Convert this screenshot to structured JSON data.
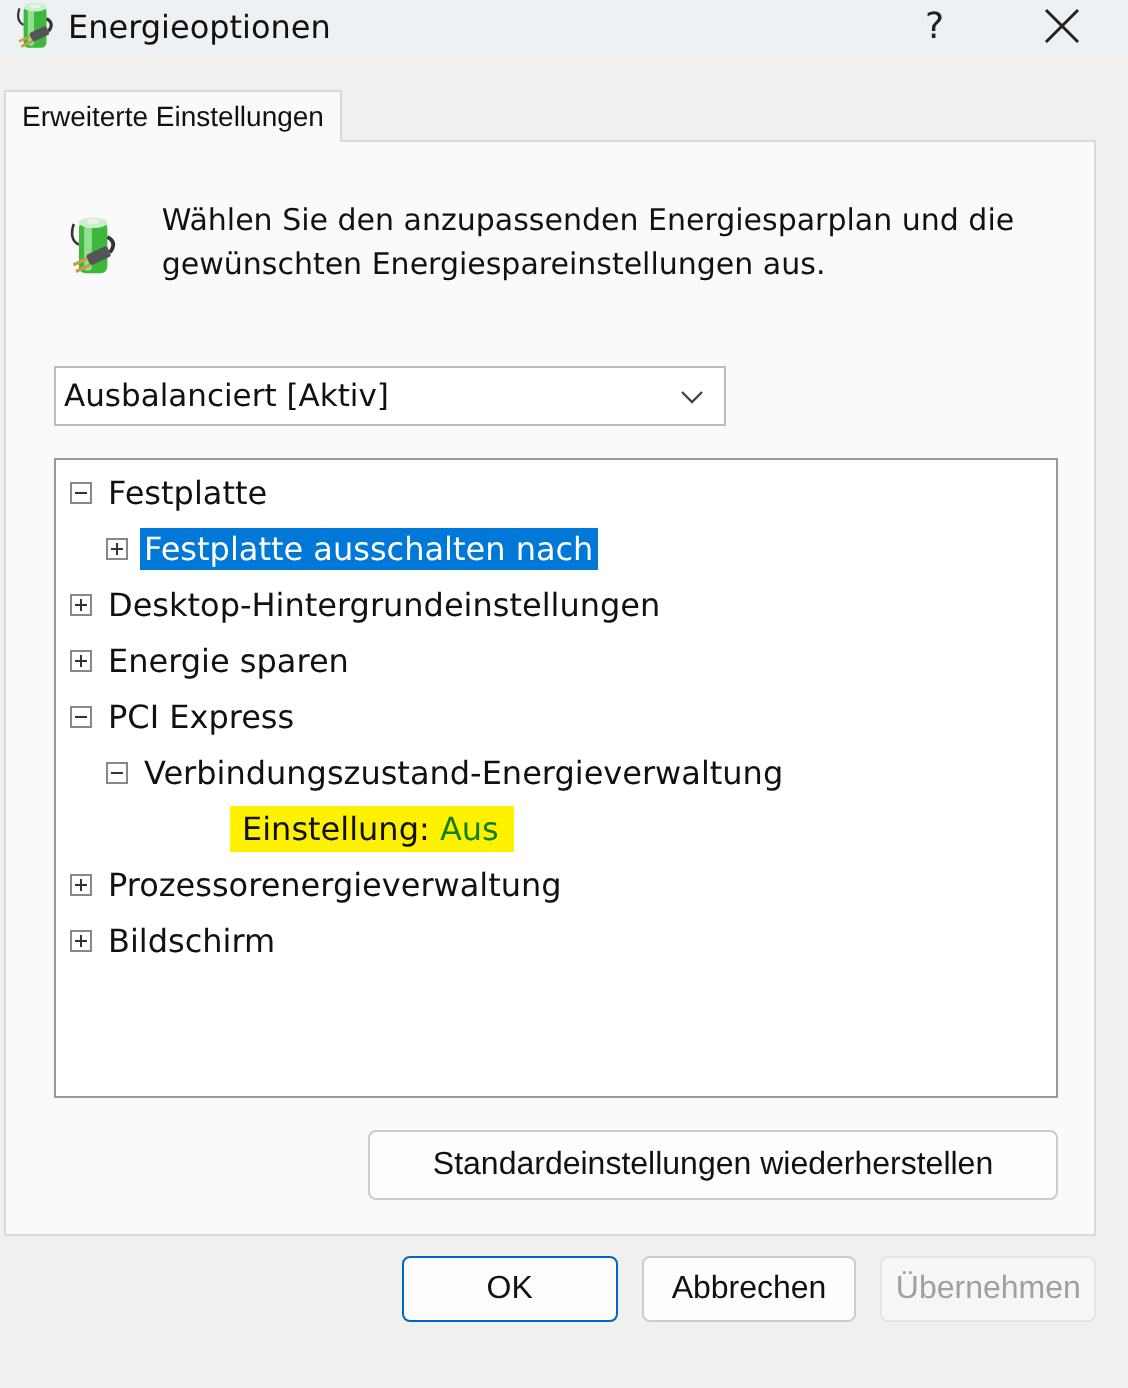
{
  "window": {
    "title": "Energieoptionen",
    "help": "?"
  },
  "tabs": [
    {
      "label": "Erweiterte Einstellungen",
      "selected": true
    }
  ],
  "intro": "Wählen Sie den anzupassenden Energiesparplan und die gewünschten Energiespareinstellungen aus.",
  "plan_dropdown": {
    "value": "Ausbalanciert [Aktiv]"
  },
  "tree": [
    {
      "label": "Festplatte",
      "expanded": true,
      "selected": false,
      "children": [
        {
          "label": "Festplatte ausschalten nach",
          "expanded": false,
          "selected": true
        }
      ]
    },
    {
      "label": "Desktop-Hintergrundeinstellungen",
      "expanded": false,
      "selected": false
    },
    {
      "label": "Energie sparen",
      "expanded": false,
      "selected": false
    },
    {
      "label": "PCI Express",
      "expanded": true,
      "selected": false,
      "children": [
        {
          "label": "Verbindungszustand-Energieverwaltung",
          "expanded": true,
          "selected": false,
          "children": [
            {
              "kind": "setting",
              "label": "Einstellung:",
              "value": "Aus",
              "highlighted": true
            }
          ]
        }
      ]
    },
    {
      "label": "Prozessorenergieverwaltung",
      "expanded": false,
      "selected": false
    },
    {
      "label": "Bildschirm",
      "expanded": false,
      "selected": false
    }
  ],
  "restore_button": "Standardeinstellungen wiederherstellen",
  "buttons": [
    {
      "label": "OK",
      "kind": "default",
      "disabled": false
    },
    {
      "label": "Abbrechen",
      "kind": "normal",
      "disabled": false
    },
    {
      "label": "Übernehmen",
      "kind": "normal",
      "disabled": true
    }
  ]
}
